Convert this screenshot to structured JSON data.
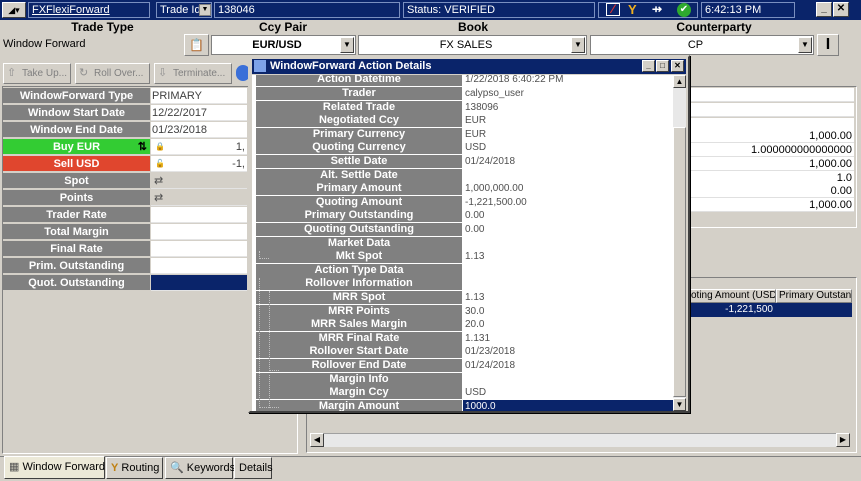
{
  "topbar": {
    "trade_type_link": "FXFlexiForward",
    "trade_id_label": "Trade Id",
    "trade_id_value": "138046",
    "status": "Status: VERIFIED",
    "time": "6:42:13 PM"
  },
  "headers": {
    "trade_type": "Trade Type",
    "ccy_pair": "Ccy Pair",
    "book": "Book",
    "counterparty": "Counterparty"
  },
  "fields": {
    "trade_type": "Window Forward",
    "ccy_pair": "EUR/USD",
    "book": "FX SALES",
    "counterparty": "CP"
  },
  "actions": [
    {
      "label": "Take Up..."
    },
    {
      "label": "Roll Over..."
    },
    {
      "label": "Terminate..."
    }
  ],
  "left_grid": {
    "rows": [
      {
        "label": "WindowForward Type",
        "value": "PRIMARY"
      },
      {
        "label": "Window Start Date",
        "value": "12/22/2017"
      },
      {
        "label": "Window End Date",
        "value": "01/23/2018"
      },
      {
        "label": "Buy EUR",
        "value": "1,"
      },
      {
        "label": "Sell USD",
        "value": "-1,"
      },
      {
        "label": "Spot",
        "value": ""
      },
      {
        "label": "Points",
        "value": ""
      },
      {
        "label": "Trader Rate",
        "value": ""
      },
      {
        "label": "Total Margin",
        "value": ""
      },
      {
        "label": "Final Rate",
        "value": ""
      },
      {
        "label": "Prim. Outstanding",
        "value": ""
      },
      {
        "label": "Quot. Outstanding",
        "value": ""
      }
    ],
    "buy_color": "#33cc33",
    "sell_color": "#e0462e"
  },
  "right_values": [
    "",
    "",
    "",
    "1,000.00",
    "1.000000000000000",
    "1,000.00",
    "1.0",
    "0.00",
    "1,000.00"
  ],
  "right_table": {
    "headers": [
      "oting Amount (USD)",
      "Primary Outstan"
    ],
    "row": [
      "-1,221,500",
      ""
    ]
  },
  "dialog": {
    "title": "WindowForward Action Details",
    "rows": [
      {
        "label": "Action Datetime",
        "value": "1/22/2018 6:40:22 PM"
      },
      {
        "label": "Trader",
        "value": "calypso_user"
      },
      {
        "label": "Related Trade",
        "value": "138096"
      },
      {
        "label": "Negotiated Ccy",
        "value": "EUR"
      },
      {
        "label": "Primary Currency",
        "value": "EUR"
      },
      {
        "label": "Quoting Currency",
        "value": "USD"
      },
      {
        "label": "Settle Date",
        "value": "01/24/2018"
      },
      {
        "label": "Alt. Settle Date",
        "value": ""
      },
      {
        "label": "Primary Amount",
        "value": "1,000,000.00"
      },
      {
        "label": "Quoting Amount",
        "value": "-1,221,500.00"
      },
      {
        "label": "Primary Outstanding",
        "value": "0.00"
      },
      {
        "label": "Quoting Outstanding",
        "value": "0.00"
      },
      {
        "label": "Market Data",
        "value": ""
      },
      {
        "label": "Mkt Spot",
        "value": "1.13"
      },
      {
        "label": "Action Type Data",
        "value": ""
      },
      {
        "label": "Rollover Information",
        "value": ""
      },
      {
        "label": "MRR Spot",
        "value": "1.13"
      },
      {
        "label": "MRR Points",
        "value": "30.0"
      },
      {
        "label": "MRR Sales Margin",
        "value": "20.0"
      },
      {
        "label": "MRR Final Rate",
        "value": "1.131"
      },
      {
        "label": "Rollover Start Date",
        "value": "01/23/2018"
      },
      {
        "label": "Rollover End Date",
        "value": "01/24/2018"
      },
      {
        "label": "Margin Info",
        "value": ""
      },
      {
        "label": "Margin Ccy",
        "value": "USD"
      },
      {
        "label": "Margin Amount",
        "value": "1000.0"
      }
    ]
  },
  "tabs": [
    {
      "label": "Window Forward",
      "icon": "grid-icon"
    },
    {
      "label": "Routing",
      "icon": "routing-icon"
    },
    {
      "label": "Keywords",
      "icon": "keywords-icon"
    },
    {
      "label": "Details",
      "icon": ""
    }
  ]
}
